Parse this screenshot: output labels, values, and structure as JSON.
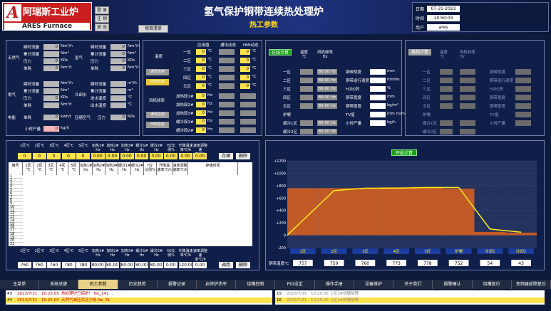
{
  "logo": {
    "mark": "A",
    "cn": "阿瑞斯工业炉",
    "en": "ARES Furnace"
  },
  "top_buttons": [
    "登 录",
    "注 销",
    "退 出"
  ],
  "project_button": "项目清单",
  "title": "氢气保护铜带连续热处理炉",
  "subtitle": "热工参数",
  "info": {
    "date_label": "日期",
    "date": "07-31-2023",
    "time_label": "时间",
    "time": "10:50:03",
    "user_label": "用户",
    "user": "ares"
  },
  "gas": {
    "natural_gas": {
      "label": "天然气",
      "rows": [
        [
          "瞬时流量",
          "0",
          "Nm³/h"
        ],
        [
          "累计流量",
          "",
          "Nm³"
        ],
        [
          "压力",
          "0",
          "KPa"
        ],
        [
          "单耗",
          "0",
          "Nm³/t"
        ]
      ]
    },
    "nitrogen": {
      "label": "氮气",
      "rows": [
        [
          "瞬时流量",
          "",
          "Nm³/h"
        ],
        [
          "累计流量",
          "",
          "Nm³"
        ],
        [
          "压力",
          "0",
          "KPa"
        ],
        [
          "单耗",
          "",
          "Nm³/t"
        ]
      ]
    },
    "hydrogen": {
      "label": "氢气",
      "rows": [
        [
          "瞬时流量",
          "0",
          "Nm³/h"
        ],
        [
          "累计流量",
          "0",
          "Nm³"
        ],
        [
          "压力",
          "0",
          "KPa"
        ],
        [
          "单耗",
          "0",
          "Nm³/t"
        ]
      ]
    },
    "cooling": {
      "label": "冷却水",
      "rows": [
        [
          "瞬时流量",
          "",
          "m³/h"
        ],
        [
          "累计流量",
          "",
          "m³"
        ],
        [
          "进水温度",
          "",
          "℃"
        ],
        [
          "出水温度",
          "",
          "℃"
        ]
      ]
    },
    "electric": {
      "label": "电能",
      "rows": [
        [
          "单耗",
          "0",
          "kwh/t"
        ]
      ]
    },
    "compressed_air": {
      "label": "压缩空气",
      "rows": [
        [
          "压力",
          "0",
          "KPa"
        ]
      ]
    },
    "hourly": {
      "label": "小时产量",
      "value": "0",
      "unit": "kg/h"
    }
  },
  "zone_panel": {
    "headers": [
      "应用值",
      "通讯动态",
      "HMI动态"
    ],
    "temp_label": "温度",
    "fan_label": "风机频率",
    "zones": [
      "一区",
      "二区",
      "三区",
      "四区",
      "五区"
    ],
    "zone_units": [
      "℃",
      "℃",
      "℃",
      "℃",
      "℃"
    ],
    "fans": [
      "加热段1#",
      "加热段2#",
      "加热段3#",
      "缓冷段1#",
      "缓冷段2#"
    ],
    "fan_units": [
      "Hz",
      "Hz",
      "Hz",
      "Hz",
      "Hz"
    ],
    "buttons": [
      "通讯应用",
      "HMI应用",
      "通讯应用",
      "HMI应用"
    ]
  },
  "calc1": {
    "button": "在线计算",
    "col1": "温度\n℃",
    "col2": "风机频率\nHz",
    "zones": [
      "一区",
      "二区",
      "三区",
      "四区",
      "五区",
      "炉喉",
      "缓冷1区",
      "缓冷2区"
    ],
    "col2_vals": [
      "80.00 Hz",
      "80.00 Hz",
      "80.00 Hz",
      "80.00 Hz",
      "80.00 Hz",
      "",
      "80.00 Hz",
      "80.00 Hz"
    ],
    "params": [
      [
        "铜带厚度",
        "",
        "mm"
      ],
      [
        "铜带运行速度",
        "",
        "m/min"
      ],
      [
        "H2比例",
        "",
        "%"
      ],
      [
        "铜带宽度",
        "",
        "mm"
      ],
      [
        "铜带密度",
        "",
        "kg/m³"
      ],
      [
        "TV值",
        "",
        "mm m/min"
      ],
      [
        "小时产量",
        "",
        "kg/h"
      ]
    ]
  },
  "calc2": {
    "button": "离线计算",
    "col1": "温度\n℃",
    "col2": "风机频率\nHz",
    "zones": [
      "一区",
      "二区",
      "三区",
      "四区",
      "五区",
      "炉喉",
      "缓冷1区",
      "缓冷2区"
    ],
    "params": [
      "铜带厚度",
      "铜带运行速度",
      "H2比例",
      "铜带宽度",
      "铜带密度",
      "TV值",
      "小时产量"
    ]
  },
  "summary": {
    "headers": [
      "1区℃",
      "2区℃",
      "3区℃",
      "4区℃",
      "5区℃",
      "加热1# Hz",
      "加热2# Hz",
      "加热3# Hz",
      "缓冷1# Hz",
      "缓冷2# Hz",
      "H2比例%",
      "升降温速率℃/h",
      "速率调整速率℃/h"
    ],
    "values": [
      "0",
      "0",
      "0",
      "0",
      "0",
      "0.00",
      "0.00",
      "0.00",
      "0.00",
      "0.00",
      "0.00",
      "0.00",
      "0.00"
    ],
    "btn_save": "存储",
    "btn_delete": "删除"
  },
  "table": {
    "headers": [
      "编号",
      "1区\n℃",
      "2区\n℃",
      "3区\n℃",
      "4区\n℃",
      "5区\n℃",
      "加热1#\nHz",
      "加热2#\nHz",
      "加热3#\nHz",
      "缓冷1#\nHz",
      "缓冷2#\nHz",
      "H2\n比例%",
      "升降温\n速率℃/h",
      "速率调整\n速率℃/h",
      "存储时间"
    ],
    "rows": [
      "1",
      "2",
      "3",
      "4",
      "5",
      "6",
      "7",
      "8",
      "9",
      "10",
      "11",
      "12",
      "13",
      "14",
      "15",
      "16",
      "17",
      "18",
      "19",
      "20",
      "21"
    ]
  },
  "bottom_summary": {
    "headers": [
      "1区℃",
      "2区℃",
      "3区℃",
      "4区℃",
      "5区℃",
      "加热1# Hz",
      "加热2# Hz",
      "加热3# Hz",
      "缓冷1# Hz",
      "缓冷2# Hz",
      "H2比例%",
      "升降温速率℃/h",
      "速率调整速率℃/h"
    ],
    "values": [
      "760",
      "760",
      "760",
      "780",
      "780",
      "80.00",
      "80.00",
      "80.00",
      "80.00",
      "80.00",
      "0.00",
      "120.00",
      "0.00"
    ],
    "btn_call": "调用",
    "btn_delete": "删除"
  },
  "chart_data": {
    "type": "area",
    "button": "开始计算",
    "y_ticks": [
      "+1200",
      "+1000",
      "+800",
      "+600",
      "+400",
      "+200",
      "0",
      "-200"
    ],
    "ylim": [
      -200,
      1200
    ],
    "x_labels": [
      "1区",
      "2区",
      "3区",
      "4区",
      "5区",
      "炉喉",
      "冷却1",
      "冷却2"
    ],
    "series": [
      {
        "values": [
          760,
          760,
          760,
          773,
          778,
          752,
          54,
          43
        ]
      },
      {
        "values": [
          0,
          720,
          760,
          760,
          770,
          770,
          100,
          50
        ]
      }
    ],
    "bottom_label": "铜带温度℃",
    "bottom_values": [
      "757",
      "759",
      "760",
      "773",
      "778",
      "752",
      "54",
      "43"
    ]
  },
  "menu": [
    "主菜单",
    "系统总貌",
    "热工参数",
    "历史趋势",
    "报警记录",
    "启停炉步序",
    "烧嘴控制",
    "PID设定",
    "操作手册",
    "设备维护",
    "关于我们",
    "报警确认",
    "烧嘴复位",
    "变频器故障复位"
  ],
  "alarms": {
    "left": [
      [
        "43",
        "2023/7/31",
        "10:25:05",
        "热处理炉已保护！ No_141"
      ],
      [
        "44",
        "2023/7/31",
        "10:25:05",
        "天然气减压后压力低 No_31"
      ]
    ],
    "right": [
      [
        "15",
        "2023/7/31",
        "10:25:00",
        "1区3#烧嘴故障"
      ],
      [
        "16",
        "2023/7/31",
        "10:25:00",
        "1区3#烧嘴故障"
      ]
    ]
  },
  "colors": {
    "bg": "#0e1a3c",
    "panel": "#101e4a",
    "area": "#c25a28",
    "line": "#ffe91a",
    "accent": "#ffd31a"
  }
}
